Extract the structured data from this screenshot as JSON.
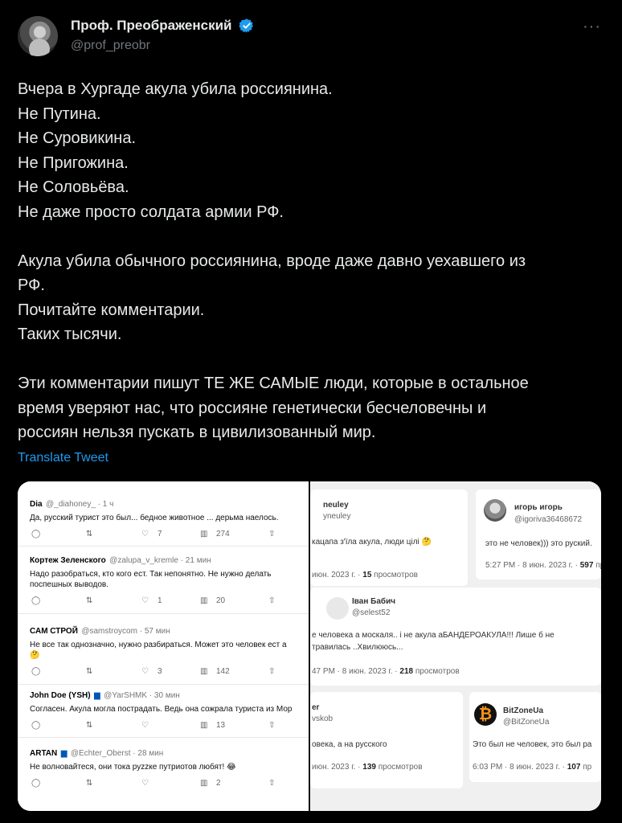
{
  "author": {
    "name": "Проф. Преображенский",
    "handle": "@prof_preobr"
  },
  "more_label": "···",
  "tweet_lines": [
    "Вчера в Хургаде акула убила россиянина.",
    "Не Путина.",
    "Не Суровикина.",
    "Не Пригожина.",
    "Не Соловьёва.",
    "Не даже просто солдата армии РФ.",
    "",
    "Акула убила обычного россиянина, вроде даже давно уехавшего из",
    "РФ.",
    "Почитайте комментарии.",
    "Таких тысячи.",
    "",
    "Эти комментарии пишут ТЕ ЖЕ САМЫЕ люди, которые в остальное",
    "время уверяют нас, что россияне генетически бесчеловечны и",
    "россиян нельзя пускать в цивилизованный мир."
  ],
  "translate_label": "Translate Tweet",
  "left_comments": [
    {
      "name": "Dia",
      "handle": "@_diahoney_ · 1 ч",
      "text": "Да, русский турист это был... бедное животное ... дерьма наелось.",
      "reply": "",
      "likes": "7",
      "views": "274"
    },
    {
      "name": "Кортеж Зеленского",
      "handle": "@zalupa_v_kremle · 21 мин",
      "text": "Надо разобраться, кто кого ест. Так непонятно. Не нужно делать",
      "text2": "поспешных выводов.",
      "likes": "1",
      "views": "20"
    },
    {
      "name": "САМ СТРОЙ",
      "handle": "@samstroycom · 57 мин",
      "text": "Не все так однозначно, нужно разбираться. Может это человек ест а",
      "text2": "🤔",
      "likes": "3",
      "views": "142"
    },
    {
      "name": "John Doe (YSH)",
      "handle": "@YarSHMK · 30 мин",
      "text": "Согласен. Акула могла пострадать. Ведь она сожрала туриста из Мор",
      "likes": "",
      "views": "13"
    },
    {
      "name": "ARTAN",
      "handle": "@Echter_Oberst · 28 мин",
      "text": "Не волновайтеся, они тока руzzке путриотов любят! 😂",
      "likes": "",
      "views": "2"
    }
  ],
  "right_cards": {
    "c1": {
      "name": "neuley",
      "handle": "yneuley",
      "text": "кацапа з'їла акула, люди цілі 🤔",
      "meta_pre": "июн. 2023 г. · ",
      "meta_num": "15",
      "meta_post": " просмотров"
    },
    "c2": {
      "name": "игорь игорь",
      "handle": "@igoriva36468672",
      "text": "это не человек))) это руский.",
      "meta_pre": "5:27 PM · 8 июн. 2023 г. · ",
      "meta_num": "597",
      "meta_post": " пр"
    },
    "c3": {
      "name": "Іван Бабич",
      "handle": "@selest52",
      "text": "е человека а москаля.. і не акула аБАНДЕРОАКУЛА!!! Лише б не",
      "text2": "травилась ..Хвилююсь...",
      "meta_pre": "47 PM · 8 июн. 2023 г. · ",
      "meta_num": "218",
      "meta_post": " просмотров"
    },
    "c4": {
      "name": "er",
      "handle": "vskob",
      "text": "овека, а на русского",
      "meta_pre": "июн. 2023 г. · ",
      "meta_num": "139",
      "meta_post": " просмотров"
    },
    "c5": {
      "name": "BitZoneUa",
      "handle": "@BitZoneUa",
      "text": "Это был не человек, это был ра",
      "meta_pre": "6:03 PM · 8 июн. 2023 г. · ",
      "meta_num": "107",
      "meta_post": " пр"
    }
  },
  "colors": {
    "link": "#1d9bf0",
    "verified": "#1d9bf0",
    "background": "#000000"
  }
}
